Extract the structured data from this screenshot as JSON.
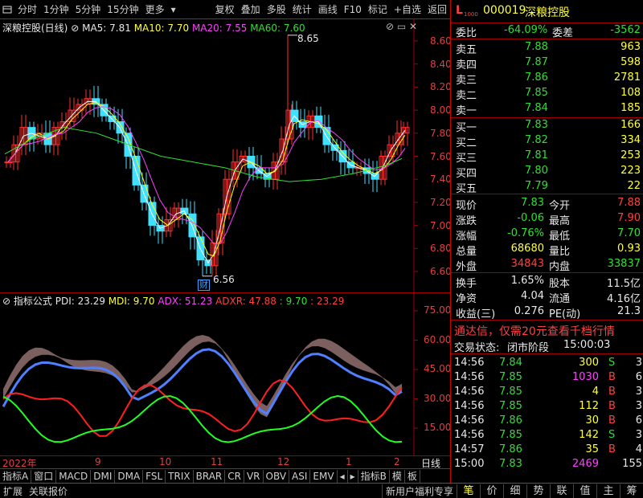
{
  "toolbar": {
    "items": [
      "分时",
      "1分钟",
      "5分钟",
      "15分钟",
      "更多"
    ],
    "right_items": [
      "复权",
      "叠加",
      "多股",
      "统计",
      "画线",
      "F10",
      "标记",
      "+自选",
      "返回"
    ]
  },
  "main_pane": {
    "title": "深粮控股(日线)",
    "ma5": "MA5: 7.81",
    "ma10": "MA10: 7.70",
    "ma20": "MA20: 7.55",
    "ma60": "MA60: 7.60",
    "high_mark": "8.65",
    "low_mark": "6.56",
    "flag": "财",
    "y_ticks": [
      "8.60",
      "8.40",
      "8.20",
      "8.00",
      "7.80",
      "7.60",
      "7.40",
      "7.20",
      "7.00",
      "6.80",
      "6.60"
    ]
  },
  "ind_pane": {
    "title": "指标公式",
    "pdi": "PDI: 23.29",
    "mdi": "MDI: 9.70",
    "adx": "ADX: 51.23",
    "adxr": "ADXR: 47.88",
    "v1": ": 9.70",
    "v2": ": 23.29",
    "y_ticks": [
      "75.00",
      "60.00",
      "45.00",
      "30.00",
      "15.00"
    ]
  },
  "x_axis": {
    "labels": [
      "2022年",
      "9",
      "10",
      "11",
      "12",
      "1",
      "2"
    ],
    "mode": "日线"
  },
  "colors": {
    "up": "#ff3030",
    "down": "#40e0ff",
    "ma5": "#ffffff",
    "ma10": "#ffff00",
    "ma20": "#ff40ff",
    "ma60": "#30e030",
    "grid": "#a00000"
  },
  "quote": {
    "code": "000019",
    "name": "深粮控股",
    "weibi_label": "委比",
    "weibi": "-64.09%",
    "weicha_label": "委差",
    "weicha": "-3562",
    "sells": [
      {
        "label": "卖五",
        "price": "7.88",
        "vol": "963"
      },
      {
        "label": "卖四",
        "price": "7.87",
        "vol": "598"
      },
      {
        "label": "卖三",
        "price": "7.86",
        "vol": "2781"
      },
      {
        "label": "卖二",
        "price": "7.85",
        "vol": "108"
      },
      {
        "label": "卖一",
        "price": "7.84",
        "vol": "185"
      }
    ],
    "buys": [
      {
        "label": "买一",
        "price": "7.83",
        "vol": "166"
      },
      {
        "label": "买二",
        "price": "7.82",
        "vol": "334"
      },
      {
        "label": "买三",
        "price": "7.81",
        "vol": "253"
      },
      {
        "label": "买四",
        "price": "7.80",
        "vol": "223"
      },
      {
        "label": "买五",
        "price": "7.79",
        "vol": "22"
      }
    ],
    "stats": [
      {
        "l1": "现价",
        "v1": "7.83",
        "l2": "今开",
        "v2": "7.88"
      },
      {
        "l1": "涨跌",
        "v1": "-0.06",
        "l2": "最高",
        "v2": "7.90"
      },
      {
        "l1": "涨幅",
        "v1": "-0.76%",
        "l2": "最低",
        "v2": "7.70"
      },
      {
        "l1": "总量",
        "v1": "68680",
        "l2": "量比",
        "v2": "0.93"
      },
      {
        "l1": "外盘",
        "v1": "34843",
        "l2": "内盘",
        "v2": "33837"
      }
    ],
    "stats2": [
      {
        "l1": "换手",
        "v1": "1.65%",
        "l2": "股本",
        "v2": "11.5亿"
      },
      {
        "l1": "净资",
        "v1": "4.04",
        "l2": "流通",
        "v2": "4.16亿"
      },
      {
        "l1": "收益(三)",
        "v1": "0.276",
        "l2": "PE(动)",
        "v2": "21.3"
      }
    ],
    "promo": "通达信，仅需20元查看千档行情",
    "trade_status_label": "交易状态:",
    "trade_status": "闭市阶段",
    "trade_time": "15:00:03",
    "ticks": [
      {
        "t": "14:56",
        "p": "7.84",
        "v": "300",
        "d": "S"
      },
      {
        "t": "14:56",
        "p": "7.85",
        "v": "1030",
        "d": "B"
      },
      {
        "t": "14:56",
        "p": "7.85",
        "v": "4",
        "d": "B"
      },
      {
        "t": "14:56",
        "p": "7.85",
        "v": "112",
        "d": "B"
      },
      {
        "t": "14:56",
        "p": "7.86",
        "v": "30",
        "d": "B"
      },
      {
        "t": "14:56",
        "p": "7.85",
        "v": "142",
        "d": "S"
      },
      {
        "t": "14:57",
        "p": "7.86",
        "v": "35",
        "d": "B"
      },
      {
        "t": "15:00",
        "p": "7.83",
        "v": "2469",
        "d": ""
      }
    ],
    "tick_side_nums": [
      "3",
      "6",
      "3",
      "3",
      "6",
      "3",
      "4",
      "155"
    ]
  },
  "bottombar": {
    "items": [
      "指标A",
      "窗口",
      "MACD",
      "DMI",
      "DMA",
      "FSL",
      "TRIX",
      "BRAR",
      "CR",
      "VR",
      "OBV",
      "ASI",
      "EMV",
      "指标B",
      "模",
      "板"
    ]
  },
  "statusbar": {
    "left": [
      "扩展",
      "关联报价"
    ],
    "promo": "新用户福利专享",
    "tabs": [
      "笔",
      "价",
      "细",
      "势",
      "联",
      "值",
      "主",
      "筹"
    ]
  }
}
